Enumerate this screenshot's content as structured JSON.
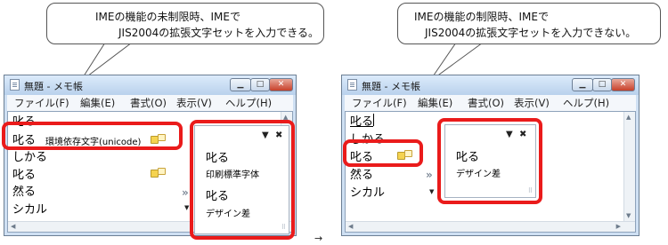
{
  "left": {
    "callout": {
      "line1": "IMEの機能の未制限時、IMEで",
      "line2": "JIS2004の拡張文字セットを入力できる。"
    },
    "window": {
      "title": "無題 - メモ帳",
      "minimize_icon": "minimize-icon",
      "maximize_icon": "maximize-icon",
      "close_icon": "close-icon"
    },
    "menu": [
      "ファイル(F)",
      "編集(E)",
      "書式(O)",
      "表示(V)",
      "ヘルプ(H)"
    ],
    "lines": [
      "叱る",
      "叱る",
      "しかる",
      "叱る",
      "然る",
      "シカル"
    ],
    "candidate_comment": "環境依存文字(unicode)",
    "candidate_marker": "»",
    "panel": {
      "items": [
        {
          "word": "叱る",
          "note": "印刷標準字体"
        },
        {
          "word": "叱る",
          "note": "デザイン差"
        }
      ],
      "dropdown_icon": "▼",
      "close_icon": "✖"
    }
  },
  "right": {
    "callout": {
      "line1": "IMEの機能の制限時、IMEで",
      "line2": "JIS2004の拡張文字セットを入力できない。"
    },
    "window": {
      "title": "無題 - メモ帳"
    },
    "menu": [
      "ファイル(F)",
      "編集(E)",
      "書式(O)",
      "表示(V)",
      "ヘルプ(H)"
    ],
    "lines": [
      "叱る",
      "しかる",
      "叱る",
      "然る",
      "シカル"
    ],
    "candidate_marker": "»",
    "panel": {
      "items": [
        {
          "word": "叱る",
          "note": "デザイン差"
        }
      ],
      "dropdown_icon": "▼",
      "close_icon": "✖"
    }
  },
  "between_arrow": "→"
}
